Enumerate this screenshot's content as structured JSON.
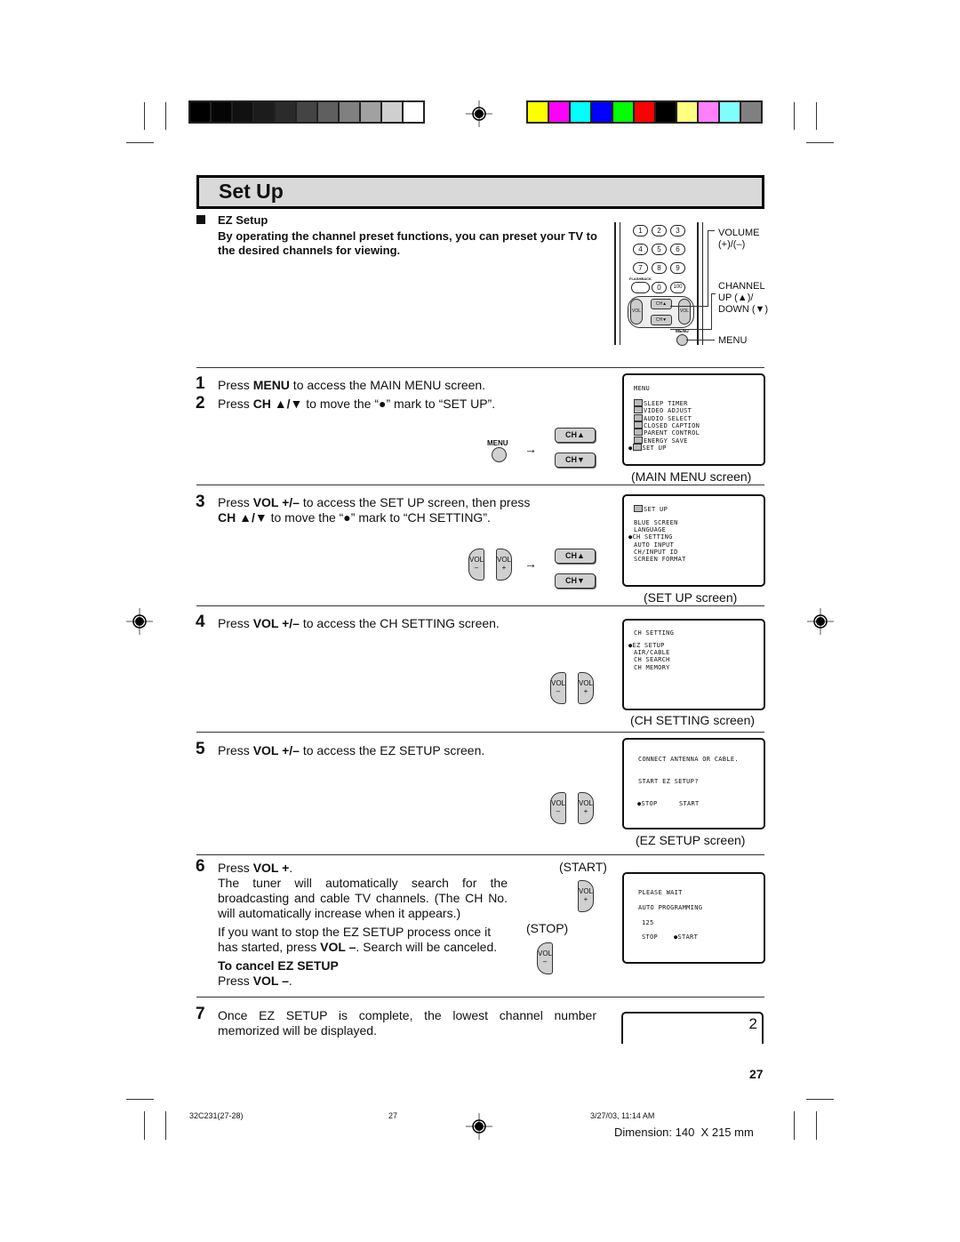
{
  "color_bars": {
    "grayscale": [
      "#000000",
      "#050505",
      "#111111",
      "#1c1c1c",
      "#2b2b2b",
      "#444444",
      "#5f5f5f",
      "#808080",
      "#a1a1a1",
      "#cfcfcf",
      "#ffffff"
    ],
    "colors": [
      "#ffff00",
      "#ff00ff",
      "#00ffff",
      "#0000ff",
      "#00ff00",
      "#ff0000",
      "#000000",
      "#ffff80",
      "#ff80ff",
      "#80ffff",
      "#808080"
    ]
  },
  "title": "Set Up",
  "section": {
    "heading": "EZ Setup",
    "intro": "By operating the channel preset functions, you can preset your TV to the desired channels for viewing."
  },
  "remote": {
    "number_keys": [
      "1",
      "2",
      "3",
      "4",
      "5",
      "6",
      "7",
      "8",
      "9",
      "0",
      "100"
    ],
    "flashback_label": "FLASHBACK",
    "ch_up": "CH▲",
    "ch_down": "CH▼",
    "vol_minus": "VOL –",
    "vol_plus": "VOL +",
    "menu_label": "MENU",
    "labels": {
      "volume": "VOLUME",
      "volume_sub": "(+)/(–)",
      "channel": "CHANNEL",
      "channel_up": "UP (▲)/",
      "channel_down": "DOWN (▼)",
      "menu": "MENU"
    }
  },
  "steps": [
    {
      "num": "1",
      "pre": "Press ",
      "bold": "MENU",
      "post": " to access the MAIN MENU screen."
    },
    {
      "num": "2",
      "pre": "Press ",
      "bold": "CH ▲/▼",
      "post": " to move the “●” mark to “SET UP”."
    },
    {
      "num": "3",
      "pre": "Press ",
      "bold": "VOL +/–",
      "post": " to access the SET UP screen, then press",
      "line2_bold": "CH ▲/▼",
      "line2_post": " to move the “●” mark to “CH SETTING”."
    },
    {
      "num": "4",
      "pre": "Press ",
      "bold": "VOL +/–",
      "post": " to access the CH SETTING screen."
    },
    {
      "num": "5",
      "pre": "Press ",
      "bold": "VOL +/–",
      "post": " to access the EZ SETUP screen."
    },
    {
      "num": "6",
      "pre": "Press ",
      "bold": "VOL +",
      "post": ".",
      "para1": "The tuner will automatically search for the broadcasting and cable TV channels. (The CH No. will automatically increase when it appears.)",
      "para2_pre": "If you want to stop the EZ SETUP process once it has started, press ",
      "para2_bold": "VOL –",
      "para2_post": ". Search will be canceled.",
      "cancel_heading": "To cancel EZ SETUP",
      "cancel_pre": "Press ",
      "cancel_bold": "VOL –",
      "cancel_post": ".",
      "start_label": "(START)",
      "stop_label": "(STOP)"
    },
    {
      "num": "7",
      "text": "Once EZ SETUP is complete, the lowest channel number memorized will be displayed."
    }
  ],
  "button_labels": {
    "menu": "MENU",
    "ch_up": "CH▲",
    "ch_down": "CH▼",
    "vol": "VOL",
    "minus": "–",
    "plus": "+",
    "arrow": "→"
  },
  "screens": {
    "main_menu": {
      "title": "MENU",
      "items": [
        "SLEEP TIMER",
        "VIDEO ADJUST",
        "AUDIO SELECT",
        "CLOSED CAPTION",
        "PARENT CONTROL",
        "ENERGY SAVE",
        "SET UP"
      ],
      "selected": "SET UP",
      "caption": "(MAIN MENU screen)"
    },
    "set_up": {
      "title": "SET UP",
      "items": [
        "BLUE SCREEN",
        "LANGUAGE",
        "CH SETTING",
        "AUTO INPUT",
        "CH/INPUT ID",
        "SCREEN FORMAT"
      ],
      "selected": "CH SETTING",
      "caption": "(SET UP screen)"
    },
    "ch_setting": {
      "title": "CH SETTING",
      "items": [
        "EZ SETUP",
        "AIR/CABLE",
        "CH SEARCH",
        "CH MEMORY"
      ],
      "selected": "EZ SETUP",
      "caption": "(CH SETTING screen)"
    },
    "ez_setup": {
      "line1": "CONNECT ANTENNA OR CABLE.",
      "line2": "START EZ SETUP?",
      "opt_stop": "●STOP",
      "opt_start": "START",
      "caption": "(EZ SETUP screen)"
    },
    "programming": {
      "line1": "PLEASE WAIT",
      "line2": "AUTO PROGRAMMING",
      "channel": "125",
      "opt_stop": "STOP",
      "opt_start": "●START"
    },
    "final": {
      "channel": "2"
    }
  },
  "page_number": "27",
  "footer": {
    "file": "32C231(27-28)",
    "page": "27",
    "timestamp": "3/27/03, 11:14 AM",
    "dimension": "Dimension: 140  X 215 mm"
  }
}
